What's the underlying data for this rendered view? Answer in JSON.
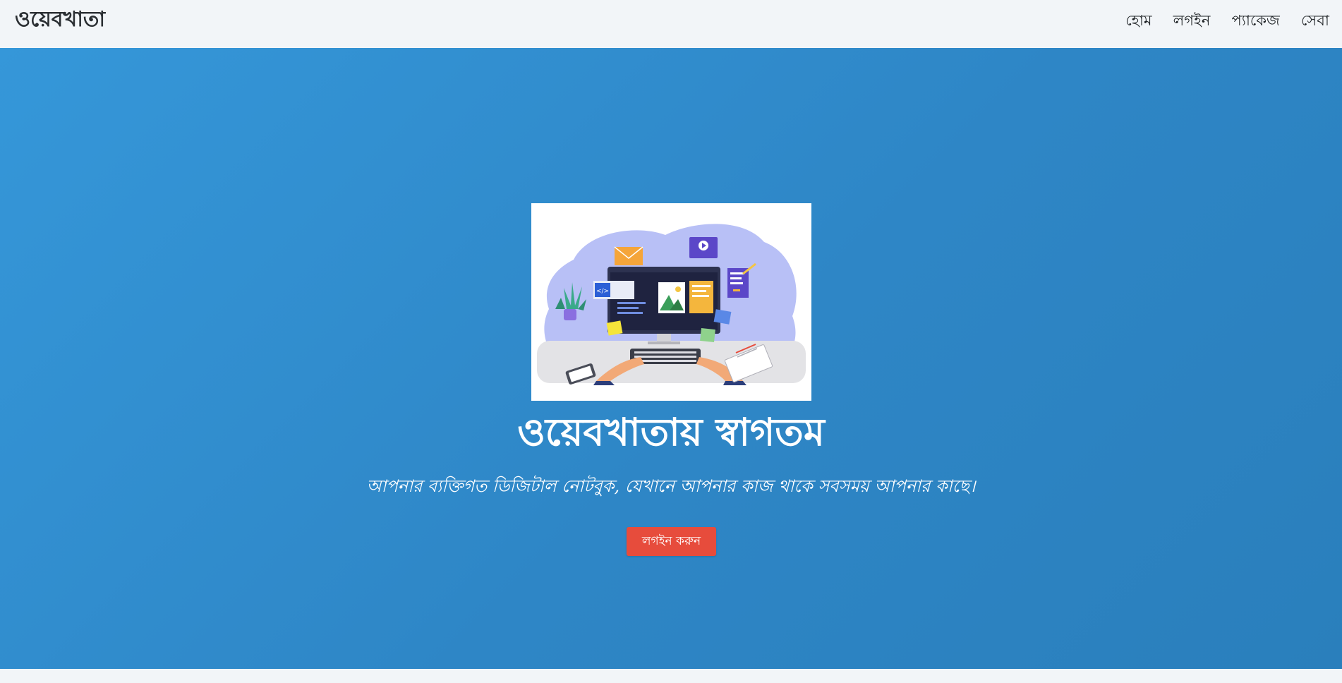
{
  "navbar": {
    "brand": "ওয়েবখাতা",
    "links": [
      {
        "label": "হোম"
      },
      {
        "label": "লগইন"
      },
      {
        "label": "প্যাকেজ"
      },
      {
        "label": "সেবা"
      }
    ]
  },
  "hero": {
    "image_alt": "workspace-illustration",
    "title": "ওয়েবখাতায় স্বাগতম",
    "subtitle": "আপনার ব্যক্তিগত ডিজিটাল নোটবুক, যেখানে আপনার কাজ থাকে সবসময় আপনার কাছে।",
    "cta_label": "লগইন করুন"
  },
  "colors": {
    "hero_background": "#3597d9",
    "cta_background": "#e74c3c",
    "navbar_background": "#f2f5f8"
  }
}
